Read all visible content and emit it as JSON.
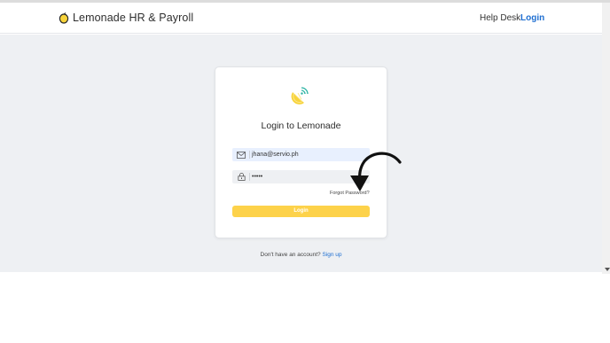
{
  "navbar": {
    "brand": "Lemonade HR & Payroll",
    "help_desk": "Help Desk",
    "login": "Login"
  },
  "login_card": {
    "title": "Login to Lemonade",
    "email_value": "jhana@servio.ph",
    "password_value": "•••••",
    "forgot_password": "Forgot Password?",
    "login_button": "Login"
  },
  "signup": {
    "prompt": "Don't have an account?",
    "link": "Sign up"
  },
  "icons": {
    "brand": "lemon-icon",
    "logo": "lemon-wifi-logo-icon",
    "email": "mail-icon",
    "password": "lock-icon",
    "annotation": "curved-arrow-icon"
  },
  "colors": {
    "accent": "#1f6fd1",
    "button": "#fdd24a",
    "lemon": "#f7d33a",
    "background": "#eef0f3"
  }
}
